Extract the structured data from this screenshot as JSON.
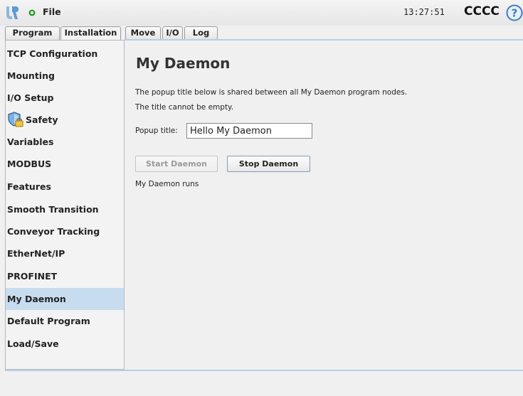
{
  "titlebar": {
    "logo_icon": "universal-robots-logo",
    "status_icon": "green-running-indicator",
    "file_menu": "File",
    "clock": "13:27:51",
    "robot_name": "CCCC",
    "help_icon": "question-mark-icon"
  },
  "tabs": {
    "top": [
      {
        "label": "Program"
      },
      {
        "label": "Installation"
      }
    ],
    "sub": [
      {
        "label": "Move"
      },
      {
        "label": "I/O"
      },
      {
        "label": "Log"
      }
    ]
  },
  "sidebar": {
    "items": [
      {
        "label": "TCP Configuration"
      },
      {
        "label": "Mounting"
      },
      {
        "label": "I/O Setup"
      },
      {
        "label": "Safety",
        "icon": "shield-lock-icon"
      },
      {
        "label": "Variables"
      },
      {
        "label": "MODBUS"
      },
      {
        "label": "Features"
      },
      {
        "label": "Smooth Transition"
      },
      {
        "label": "Conveyor Tracking"
      },
      {
        "label": "EtherNet/IP"
      },
      {
        "label": "PROFINET"
      },
      {
        "label": "My Daemon"
      },
      {
        "label": "Default Program"
      },
      {
        "label": "Load/Save"
      }
    ],
    "selected": "My Daemon"
  },
  "main": {
    "title": "My Daemon",
    "description_line1": "The popup title below is shared between all My Daemon program nodes.",
    "description_line2": "The title cannot be empty.",
    "popup_label": "Popup title:",
    "popup_value": "Hello My Daemon",
    "start_button": "Start Daemon",
    "stop_button": "Stop Daemon",
    "status": "My Daemon runs"
  },
  "colors": {
    "selection": "#c8dcf0",
    "accent_line": "#b8cfe8",
    "status_green": "#2aa02a",
    "logo_blue": "#5b9bd5"
  }
}
